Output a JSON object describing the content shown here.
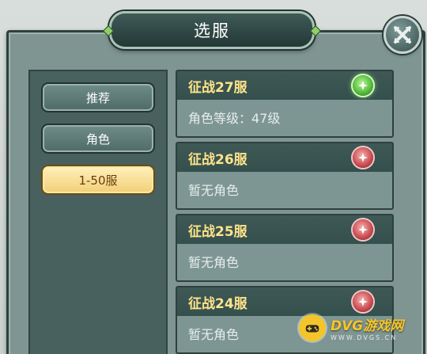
{
  "dialog": {
    "title": "选服"
  },
  "categories": [
    {
      "label": "推荐",
      "active": false
    },
    {
      "label": "角色",
      "active": false
    },
    {
      "label": "1-50服",
      "active": true
    }
  ],
  "servers": [
    {
      "name": "征战27服",
      "info": "角色等级：47级",
      "status": "green"
    },
    {
      "name": "征战26服",
      "info": "暂无角色",
      "status": "red"
    },
    {
      "name": "征战25服",
      "info": "暂无角色",
      "status": "red"
    },
    {
      "name": "征战24服",
      "info": "暂无角色",
      "status": "red"
    }
  ],
  "watermark": {
    "title": "DVG游戏网",
    "subtitle": "WWW.DVGS.CN"
  },
  "colors": {
    "server_name": "#ffe38a",
    "active_category": "#f2cf76",
    "status_online": "#4fb735",
    "status_idle": "#c8494e"
  }
}
